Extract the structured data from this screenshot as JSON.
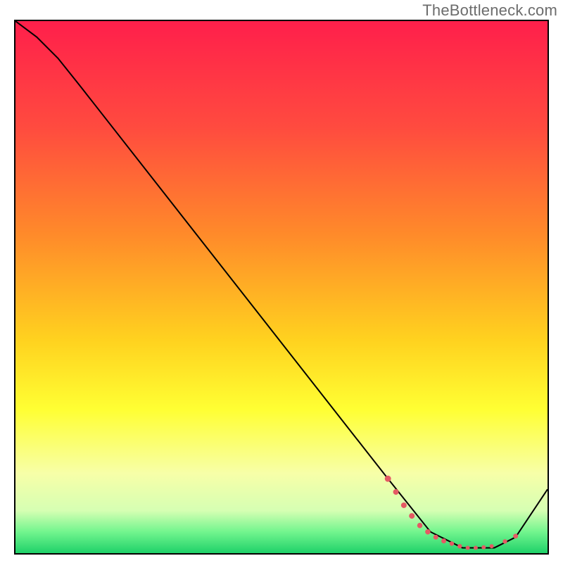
{
  "watermark": "TheBottleneck.com",
  "chart_data": {
    "type": "line",
    "title": "",
    "xlabel": "",
    "ylabel": "",
    "xlim": [
      0,
      100
    ],
    "ylim": [
      0,
      100
    ],
    "grid": false,
    "legend": false,
    "gradient_stops": [
      {
        "offset": 0,
        "color": "#ff1f4b"
      },
      {
        "offset": 20,
        "color": "#ff4b3f"
      },
      {
        "offset": 40,
        "color": "#ff8a2a"
      },
      {
        "offset": 60,
        "color": "#ffd21f"
      },
      {
        "offset": 73,
        "color": "#ffff33"
      },
      {
        "offset": 85,
        "color": "#f7ffa8"
      },
      {
        "offset": 92,
        "color": "#d6ffb3"
      },
      {
        "offset": 96,
        "color": "#72f58e"
      },
      {
        "offset": 100,
        "color": "#1fd169"
      }
    ],
    "series": [
      {
        "name": "bottleneck-curve",
        "color": "#000000",
        "x": [
          0,
          4,
          8,
          12,
          70,
          78,
          84,
          90,
          94,
          100
        ],
        "y": [
          100,
          97,
          93,
          88,
          14,
          4,
          1,
          1,
          3,
          12
        ]
      }
    ],
    "markers": {
      "name": "sweet-spot-markers",
      "color": "#e45a64",
      "x": [
        70,
        71.5,
        73,
        74.5,
        76,
        77.5,
        79,
        80.5,
        82,
        83.5,
        85,
        86.5,
        88,
        89.5,
        92,
        94
      ],
      "y": [
        14,
        11.5,
        9,
        7,
        5.2,
        4,
        3,
        2.3,
        1.8,
        1.3,
        1,
        1,
        1.1,
        1.3,
        2.2,
        3.2
      ],
      "sizes": [
        4.5,
        4,
        4,
        4,
        3.8,
        3.8,
        3.5,
        3.5,
        3.2,
        3.2,
        3,
        3,
        3,
        3,
        3.2,
        3.5
      ]
    }
  }
}
